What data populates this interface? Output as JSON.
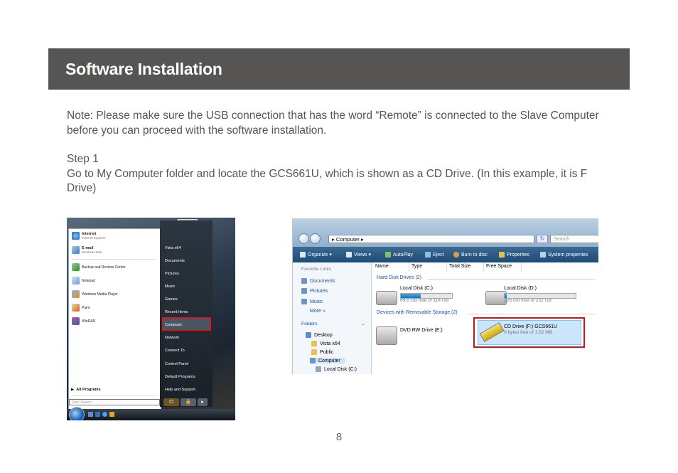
{
  "header": {
    "title": "Software Installation"
  },
  "body": {
    "note": "Note: Please make sure the USB connection that has the word “Remote” is connected to the Slave Computer before you can proceed with the software installation.",
    "step_title": "Step 1",
    "step_text": "Go to My Computer folder and locate the GCS661U, which is shown as a CD Drive. (In this example, it is F Drive)"
  },
  "page_number": "8",
  "start_menu": {
    "pinned": [
      {
        "name": "Internet",
        "sub": "Internet Explorer"
      },
      {
        "name": "E-mail",
        "sub": "Windows Mail"
      }
    ],
    "recent": [
      "Backup and Restore Center",
      "Notepad",
      "Windows Media Player",
      "Paint",
      "WinRAR"
    ],
    "all_programs": "All Programs",
    "search_placeholder": "Start Search",
    "right_items": [
      "Vista x64",
      "Documents",
      "Pictures",
      "Music",
      "Games",
      "Recent Items",
      "Computer",
      "Network",
      "Connect To",
      "Control Panel",
      "Default Programs",
      "Help and Support"
    ]
  },
  "explorer": {
    "address": "Computer",
    "search_placeholder": "Search",
    "toolbar": [
      "Organize",
      "Views",
      "AutoPlay",
      "Eject",
      "Burn to disc",
      "Properties",
      "System properties"
    ],
    "favorite_links_title": "Favorite Links",
    "favorite_links": [
      "Documents",
      "Pictures",
      "Music"
    ],
    "more": "More",
    "folders_title": "Folders",
    "tree": [
      "Desktop",
      "Vista x64",
      "Public",
      "Computer",
      "Local Disk (C:)"
    ],
    "columns": [
      "Name",
      "Type",
      "Total Size",
      "Free Space"
    ],
    "group_hdd": "Hard Disk Drives (2)",
    "group_removable": "Devices with Removable Storage (2)",
    "drives": {
      "c": {
        "name": "Local Disk (C:)",
        "free": "69.6 GB free of 114 GB",
        "used_fraction": 0.39
      },
      "d": {
        "name": "Local Disk (D:)",
        "free": "226 GB free of 232 GB",
        "used_fraction": 0.03
      },
      "e": {
        "name": "DVD RW Drive (E:)"
      },
      "f": {
        "name": "CD Drive (F:) GCS661U",
        "free": "0 bytes free of 1.52 MB"
      }
    }
  }
}
